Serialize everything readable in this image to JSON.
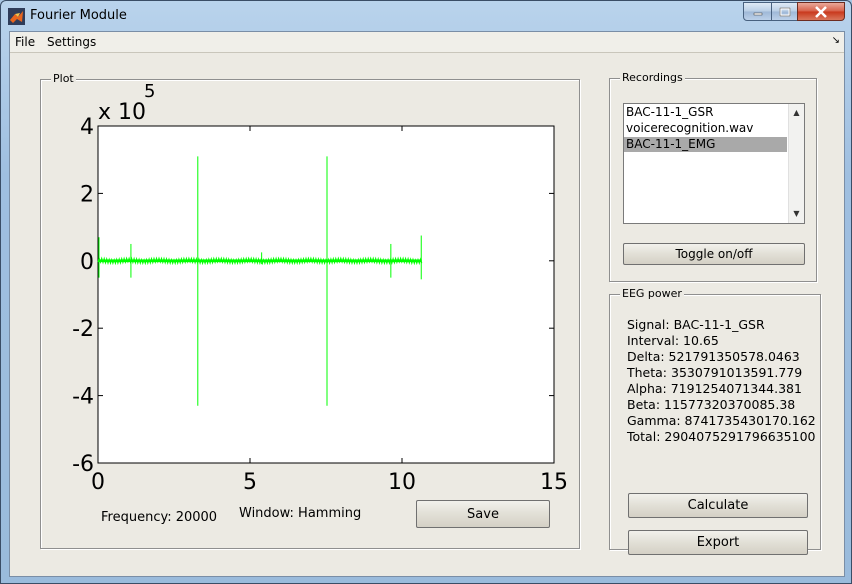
{
  "window": {
    "title": "Fourier Module"
  },
  "menu": {
    "items": [
      "File",
      "Settings"
    ]
  },
  "plot_panel": {
    "title": "Plot",
    "frequency_label": "Frequency: 20000",
    "window_label": "Window: Hamming",
    "save_label": "Save"
  },
  "chart_data": {
    "type": "line",
    "title": "",
    "xlabel": "",
    "ylabel": "",
    "exponent_label": "x 10",
    "exponent": "5",
    "xlim": [
      0,
      15
    ],
    "ylim": [
      -6,
      4
    ],
    "x_ticks": [
      "0",
      "5",
      "10",
      "15"
    ],
    "y_ticks": [
      "4",
      "2",
      "0",
      "-2",
      "-4",
      "-6"
    ],
    "grid": false,
    "color": "#00ff00",
    "baseline_x_range": [
      0,
      10.65
    ],
    "baseline_noise_amplitude": 0.08,
    "spikes": [
      {
        "x": 0.0,
        "y_max": 0.7,
        "y_min": -0.5
      },
      {
        "x": 1.05,
        "y_max": 0.5,
        "y_min": -0.5
      },
      {
        "x": 3.25,
        "y_max": 3.1,
        "y_min": -4.3
      },
      {
        "x": 5.35,
        "y_max": 0.25,
        "y_min": -0.1
      },
      {
        "x": 7.5,
        "y_max": 3.1,
        "y_min": -4.3
      },
      {
        "x": 9.6,
        "y_max": 0.5,
        "y_min": -0.5
      },
      {
        "x": 10.6,
        "y_max": 0.75,
        "y_min": -0.55
      }
    ]
  },
  "recordings_panel": {
    "title": "Recordings",
    "items": [
      "BAC-11-1_GSR",
      "voicerecognition.wav",
      "BAC-11-1_EMG"
    ],
    "selected_index": 2,
    "toggle_label": "Toggle on/off"
  },
  "eeg_panel": {
    "title": "EEG power",
    "lines": [
      "Signal: BAC-11-1_GSR",
      "Interval: 10.65",
      "Delta: 521791350578.0463",
      "Theta: 3530791013591.779",
      "Alpha: 7191254071344.381",
      "Beta: 11577320370085.38",
      "Gamma: 8741735430170.162",
      "Total: 29040752917966351​00"
    ],
    "calculate_label": "Calculate",
    "export_label": "Export"
  }
}
